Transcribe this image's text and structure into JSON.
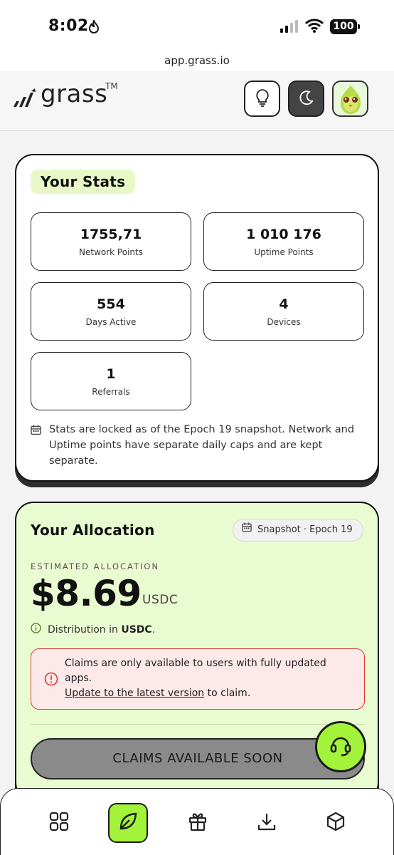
{
  "status": {
    "time": "8:02",
    "battery": "100"
  },
  "browser": {
    "url": "app.grass.io"
  },
  "header": {
    "brand": "grass",
    "trademark": "TM"
  },
  "stats": {
    "title": "Your Stats",
    "items": [
      {
        "value": "1755,71",
        "label": "Network Points"
      },
      {
        "value": "1 010 176",
        "label": "Uptime Points"
      },
      {
        "value": "554",
        "label": "Days Active"
      },
      {
        "value": "4",
        "label": "Devices"
      },
      {
        "value": "1",
        "label": "Referrals"
      }
    ],
    "note": "Stats are locked as of the Epoch 19 snapshot. Network and Uptime points have separate daily caps and are kept separate."
  },
  "allocation": {
    "title": "Your Allocation",
    "snapshot": "Snapshot · Epoch 19",
    "estimated_label": "ESTIMATED ALLOCATION",
    "amount": "$8.69",
    "unit": "USDC",
    "distribution_prefix": "Distribution in",
    "distribution_currency": "USDC",
    "distribution_suffix": ".",
    "alert_line": "Claims are only available to users with fully updated apps.",
    "alert_link": "Update to the latest version",
    "alert_suffix": " to claim.",
    "claim_button": "CLAIMS AVAILABLE SOON"
  },
  "colors": {
    "accent": "#a3f33a",
    "alloc_bg": "#e9fbd0",
    "alert_border": "#d83b3b"
  },
  "nav": {
    "icons": [
      "grid-icon",
      "leaf-icon",
      "gift-icon",
      "download-icon",
      "cube-icon"
    ],
    "active": "leaf-icon"
  }
}
